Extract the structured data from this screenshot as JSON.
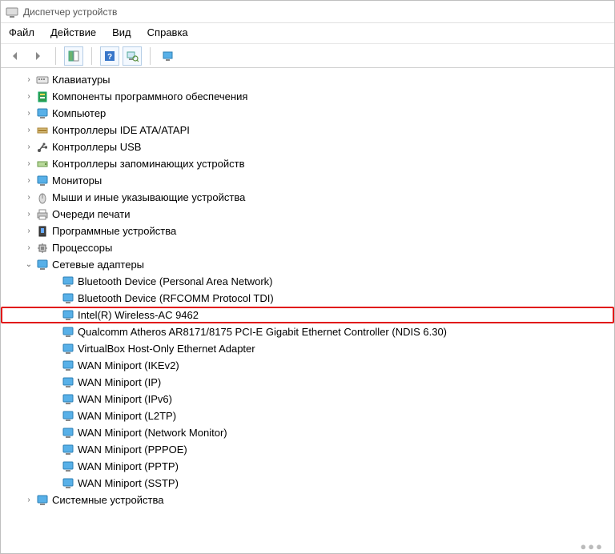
{
  "window": {
    "title": "Диспетчер устройств"
  },
  "menu": {
    "file": "Файл",
    "action": "Действие",
    "view": "Вид",
    "help": "Справка"
  },
  "categories": [
    {
      "id": "keyboards",
      "label": "Клавиатуры",
      "icon": "keyboard",
      "expanded": false
    },
    {
      "id": "software-components",
      "label": "Компоненты программного обеспечения",
      "icon": "component",
      "expanded": false
    },
    {
      "id": "computer",
      "label": "Компьютер",
      "icon": "monitor",
      "expanded": false
    },
    {
      "id": "ide-ata",
      "label": "Контроллеры IDE ATA/ATAPI",
      "icon": "ide",
      "expanded": false
    },
    {
      "id": "usb",
      "label": "Контроллеры USB",
      "icon": "usb",
      "expanded": false
    },
    {
      "id": "storage",
      "label": "Контроллеры запоминающих устройств",
      "icon": "storage",
      "expanded": false
    },
    {
      "id": "monitors",
      "label": "Мониторы",
      "icon": "monitor",
      "expanded": false
    },
    {
      "id": "mice",
      "label": "Мыши и иные указывающие устройства",
      "icon": "mouse",
      "expanded": false
    },
    {
      "id": "print-queues",
      "label": "Очереди печати",
      "icon": "printer",
      "expanded": false
    },
    {
      "id": "software-devices",
      "label": "Программные устройства",
      "icon": "software",
      "expanded": false
    },
    {
      "id": "processors",
      "label": "Процессоры",
      "icon": "cpu",
      "expanded": false
    },
    {
      "id": "network-adapters",
      "label": "Сетевые адаптеры",
      "icon": "network",
      "expanded": true,
      "children": [
        {
          "label": "Bluetooth Device (Personal Area Network)",
          "highlighted": false
        },
        {
          "label": "Bluetooth Device (RFCOMM Protocol TDI)",
          "highlighted": false
        },
        {
          "label": "Intel(R) Wireless-AC 9462",
          "highlighted": true
        },
        {
          "label": "Qualcomm Atheros AR8171/8175 PCI-E Gigabit Ethernet Controller (NDIS 6.30)",
          "highlighted": false
        },
        {
          "label": "VirtualBox Host-Only Ethernet Adapter",
          "highlighted": false
        },
        {
          "label": "WAN Miniport (IKEv2)",
          "highlighted": false
        },
        {
          "label": "WAN Miniport (IP)",
          "highlighted": false
        },
        {
          "label": "WAN Miniport (IPv6)",
          "highlighted": false
        },
        {
          "label": "WAN Miniport (L2TP)",
          "highlighted": false
        },
        {
          "label": "WAN Miniport (Network Monitor)",
          "highlighted": false
        },
        {
          "label": "WAN Miniport (PPPOE)",
          "highlighted": false
        },
        {
          "label": "WAN Miniport (PPTP)",
          "highlighted": false
        },
        {
          "label": "WAN Miniport (SSTP)",
          "highlighted": false
        }
      ]
    },
    {
      "id": "system-devices",
      "label": "Системные устройства",
      "icon": "monitor",
      "expanded": false
    }
  ]
}
